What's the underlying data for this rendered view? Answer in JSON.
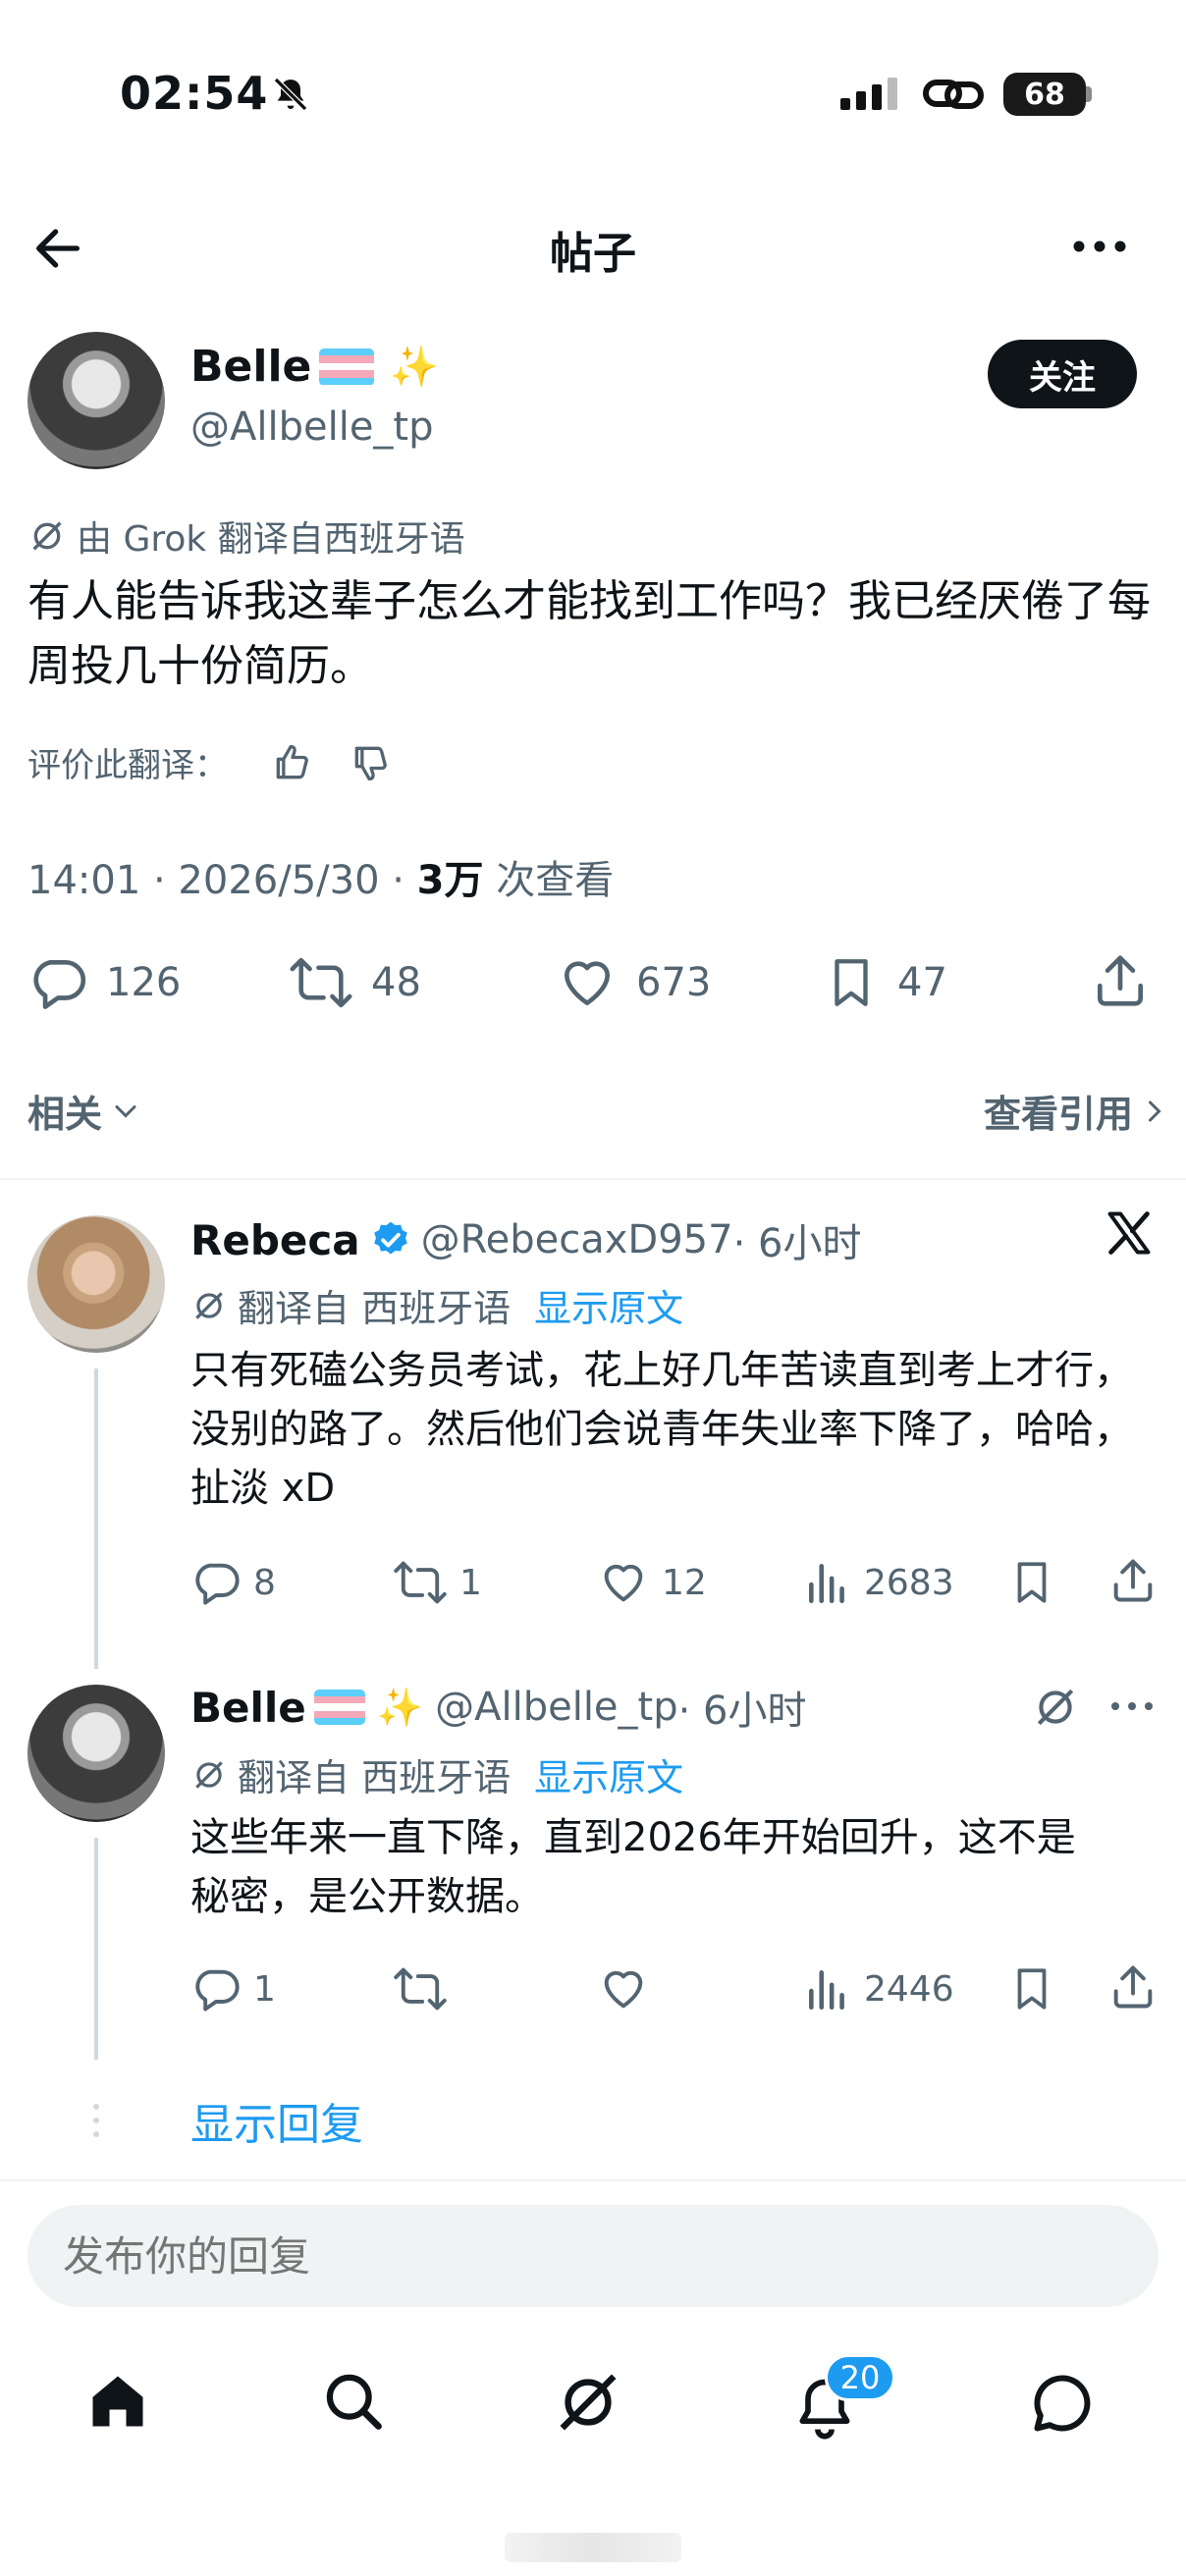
{
  "status_bar": {
    "time": "02:54",
    "battery": "68"
  },
  "header": {
    "title": "帖子"
  },
  "post": {
    "author_name": "Belle",
    "author_emoji": "✨",
    "author_handle": "@Allbelle_tp",
    "follow_label": "关注",
    "translation_note": "由 Grok 翻译自西班牙语",
    "text": "有人能告诉我这辈子怎么才能找到工作吗？我已经厌倦了每周投几十份简历。",
    "rate_translation_label": "评价此翻译：",
    "meta_time": "14:01 · 2026/5/30 · ",
    "meta_views_count": "3万",
    "meta_views_label": " 次查看",
    "stats": {
      "replies": "126",
      "reposts": "48",
      "likes": "673",
      "bookmarks": "47"
    },
    "related_label": "相关",
    "quotes_label": "查看引用"
  },
  "replies": [
    {
      "author_name": "Rebeca",
      "author_handle": "@RebecaxD957",
      "time": " · 6小时",
      "translation_label": "翻译自 西班牙语",
      "show_original": "显示原文",
      "text": "只有死磕公务员考试，花上好几年苦读直到考上才行，没别的路了。然后他们会说青年失业率下降了，哈哈，扯淡 xD",
      "stats": {
        "replies": "8",
        "reposts": "1",
        "likes": "12",
        "views": "2683"
      }
    },
    {
      "author_name": "Belle",
      "author_emoji": "✨",
      "author_handle": "@Allbelle_tp",
      "time": " · 6小时",
      "translation_label": "翻译自 西班牙语",
      "show_original": "显示原文",
      "text": "这些年来一直下降，直到2026年开始回升，这不是秘密，是公开数据。",
      "stats": {
        "replies": "1",
        "views": "2446"
      }
    }
  ],
  "show_replies_label": "显示回复",
  "compose": {
    "placeholder": "发布你的回复"
  },
  "bottom_nav": {
    "notifications_badge": "20"
  },
  "colors": {
    "accent": "#1d9bf0",
    "text": "#0f1419",
    "muted": "#536471",
    "flag_blue": "#5bcefa",
    "flag_pink": "#f5a9b8"
  }
}
